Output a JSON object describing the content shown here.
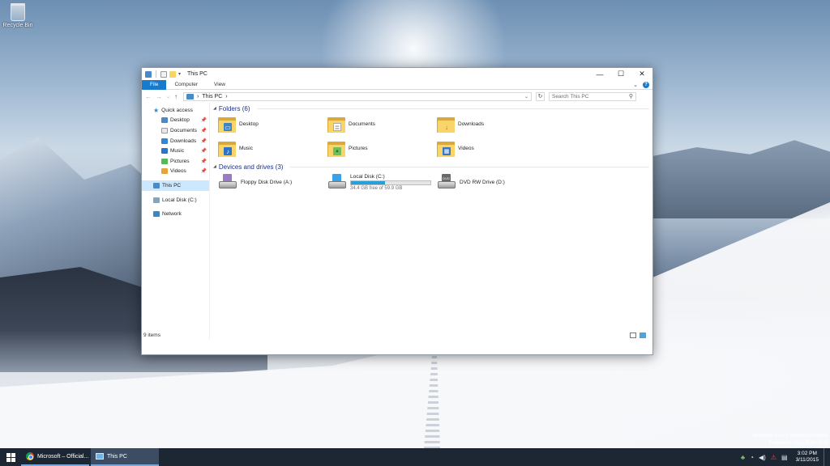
{
  "desktop": {
    "recycle_bin_label": "Recycle Bin",
    "watermark_line1": "Windows 10 Pro Technical Preview",
    "watermark_line2": "Evaluation copy. Build 9926"
  },
  "window": {
    "title": "This PC",
    "controls": {
      "minimize": "—",
      "maximize": "☐",
      "close": "✕"
    },
    "ribbon_tabs": [
      {
        "label": "File",
        "active": true
      },
      {
        "label": "Computer",
        "active": false
      },
      {
        "label": "View",
        "active": false
      }
    ],
    "ribbon_expand": "⌄",
    "help": "?",
    "address": {
      "path_root": "This PC",
      "separator1": "›",
      "separator2": "›",
      "dropdown": "⌄"
    },
    "search_placeholder": "Search This PC",
    "nav_icons": {
      "back": "←",
      "forward": "→",
      "recent": "⌄",
      "up": "↑",
      "refresh": "↻",
      "search": "⚲"
    }
  },
  "navigation_pane": {
    "quick_access": "Quick access",
    "quick_items": [
      {
        "label": "Desktop",
        "pinned": true,
        "color": "#4a8ac7"
      },
      {
        "label": "Documents",
        "pinned": true,
        "color": "#e9e9e9"
      },
      {
        "label": "Downloads",
        "pinned": true,
        "color": "#2f87d6"
      },
      {
        "label": "Music",
        "pinned": true,
        "color": "#2b74c8"
      },
      {
        "label": "Pictures",
        "pinned": true,
        "color": "#57b85a"
      },
      {
        "label": "Videos",
        "pinned": true,
        "color": "#e8a33d"
      }
    ],
    "this_pc": "This PC",
    "local_disk": "Local Disk (C:)",
    "network": "Network",
    "pin_glyph": "📌"
  },
  "content": {
    "folders_header": "Folders (6)",
    "folders": [
      {
        "label": "Desktop",
        "badge": "▭",
        "badge_color": "#3b84c9"
      },
      {
        "label": "Documents",
        "badge": "≣",
        "badge_color": "#ffffff"
      },
      {
        "label": "Downloads",
        "badge": "↓",
        "badge_color": "#f8d469"
      },
      {
        "label": "Music",
        "badge": "♪",
        "badge_color": "#2b74c8"
      },
      {
        "label": "Pictures",
        "badge": "▲",
        "badge_color": "#6cbf5c"
      },
      {
        "label": "Videos",
        "badge": "▦",
        "badge_color": "#3978c0"
      }
    ],
    "devices_header": "Devices and drives (3)",
    "drives": [
      {
        "label": "Floppy Disk Drive (A:)",
        "sub": "",
        "used_fraction": null,
        "top_color": "#9b7bc4"
      },
      {
        "label": "Local Disk (C:)",
        "sub": "34.4 GB free of 59.9 GB",
        "used_fraction": 0.43,
        "top_color": "#3aa0e8"
      },
      {
        "label": "DVD RW Drive (D:)",
        "sub": "",
        "used_fraction": null,
        "top_color": "#6a6a6a"
      }
    ]
  },
  "status": {
    "items": "9 items"
  },
  "taskbar": {
    "tasks": [
      {
        "label": "Microsoft – Official...",
        "active": false
      },
      {
        "label": "This PC",
        "active": true
      }
    ],
    "time": "3:02 PM",
    "date": "3/11/2015"
  }
}
